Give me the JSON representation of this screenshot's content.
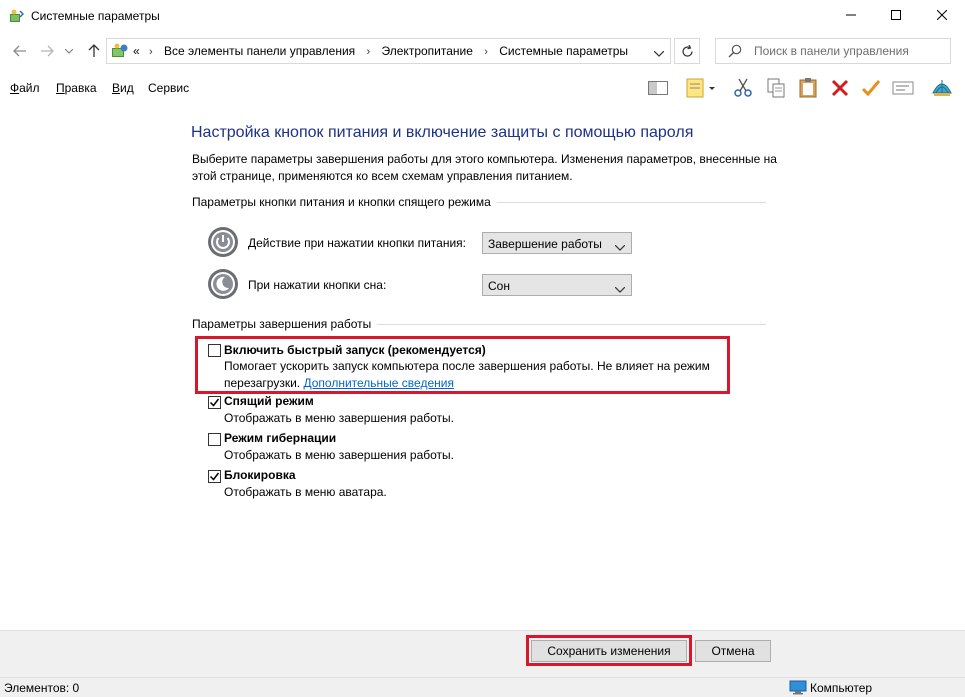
{
  "window": {
    "title": "Системные параметры",
    "icon": "power-options-icon"
  },
  "address": {
    "overflow": "«",
    "crumbs": [
      "Все элементы панели управления",
      "Электропитание",
      "Системные параметры"
    ],
    "separator": "›",
    "search_placeholder": "Поиск в панели управления"
  },
  "menu": {
    "file": "айл",
    "file_accel": "Ф",
    "edit": "равка",
    "edit_accel": "П",
    "view": "ид",
    "view_accel": "В",
    "service": "Сервис"
  },
  "content": {
    "heading": "Настройка кнопок питания и включение защиты с помощью пароля",
    "description": "Выберите параметры завершения работы для этого компьютера. Изменения параметров, внесенные на этой странице, применяются ко всем схемам управления питанием.",
    "group1_label": "Параметры кнопки питания и кнопки спящего режима",
    "power_button_label": "Действие при нажатии кнопки питания:",
    "power_button_value": "Завершение работы",
    "sleep_button_label": "При нажатии кнопки сна:",
    "sleep_button_value": "Сон",
    "group2_label": "Параметры завершения работы",
    "options": [
      {
        "label": "Включить быстрый запуск (рекомендуется)",
        "checked": false,
        "desc": "Помогает ускорить запуск компьютера после завершения работы. Не влияет на режим перезагрузки.",
        "link": "Дополнительные сведения"
      },
      {
        "label": "Спящий режим",
        "checked": true,
        "desc": "Отображать в меню завершения работы."
      },
      {
        "label": "Режим гибернации",
        "checked": false,
        "desc": "Отображать в меню завершения работы."
      },
      {
        "label": "Блокировка",
        "checked": true,
        "desc": "Отображать в меню аватара."
      }
    ]
  },
  "buttons": {
    "save": "Сохранить изменения",
    "cancel": "Отмена"
  },
  "status": {
    "items": "Элементов: 0",
    "location": "Компьютер"
  },
  "colors": {
    "heading": "#1e3287",
    "highlight": "#d8172c",
    "link": "#0066cc"
  }
}
